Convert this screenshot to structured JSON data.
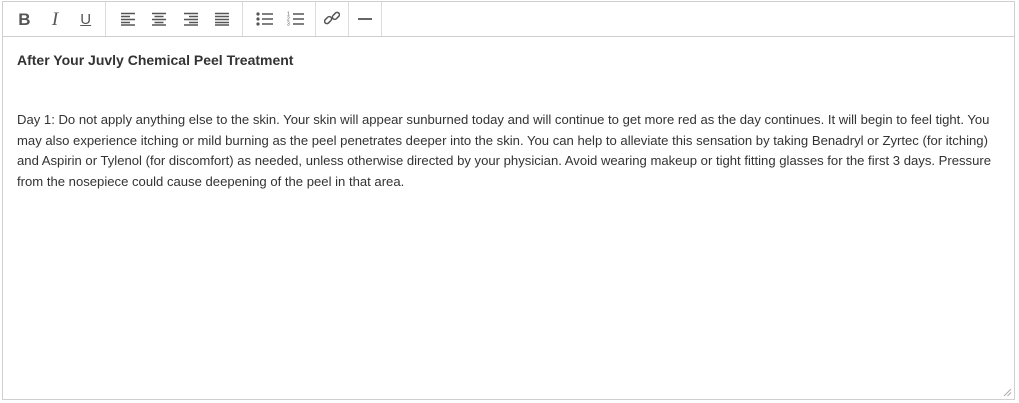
{
  "toolbar": {
    "bold_label": "B",
    "italic_label": "I",
    "underline_label": "U",
    "icons": {
      "align_left": "align-left-icon",
      "align_center": "align-center-icon",
      "align_right": "align-right-icon",
      "align_justify": "align-justify-icon",
      "bulleted_list": "bulleted-list-icon",
      "numbered_list": "numbered-list-icon",
      "link": "link-icon",
      "horizontal_rule": "horizontal-rule-icon"
    }
  },
  "document": {
    "title": "After Your Juvly Chemical Peel Treatment",
    "paragraph": "Day 1: Do not apply anything else to the skin. Your skin will appear sunburned today and will continue to get more red as the day continues. It will begin to feel tight. You may also experience itching or mild burning as the peel penetrates deeper into the skin. You can help to alleviate this sensation by taking Benadryl or Zyrtec (for itching) and Aspirin or Tylenol (for discomfort) as needed, unless otherwise directed by your physician. Avoid wearing makeup or tight fitting glasses for the first 3 days. Pressure from the nosepiece could cause deepening of the peel in that area."
  },
  "colors": {
    "border": "#cfcfcf",
    "icon": "#555555",
    "text": "#333333"
  }
}
